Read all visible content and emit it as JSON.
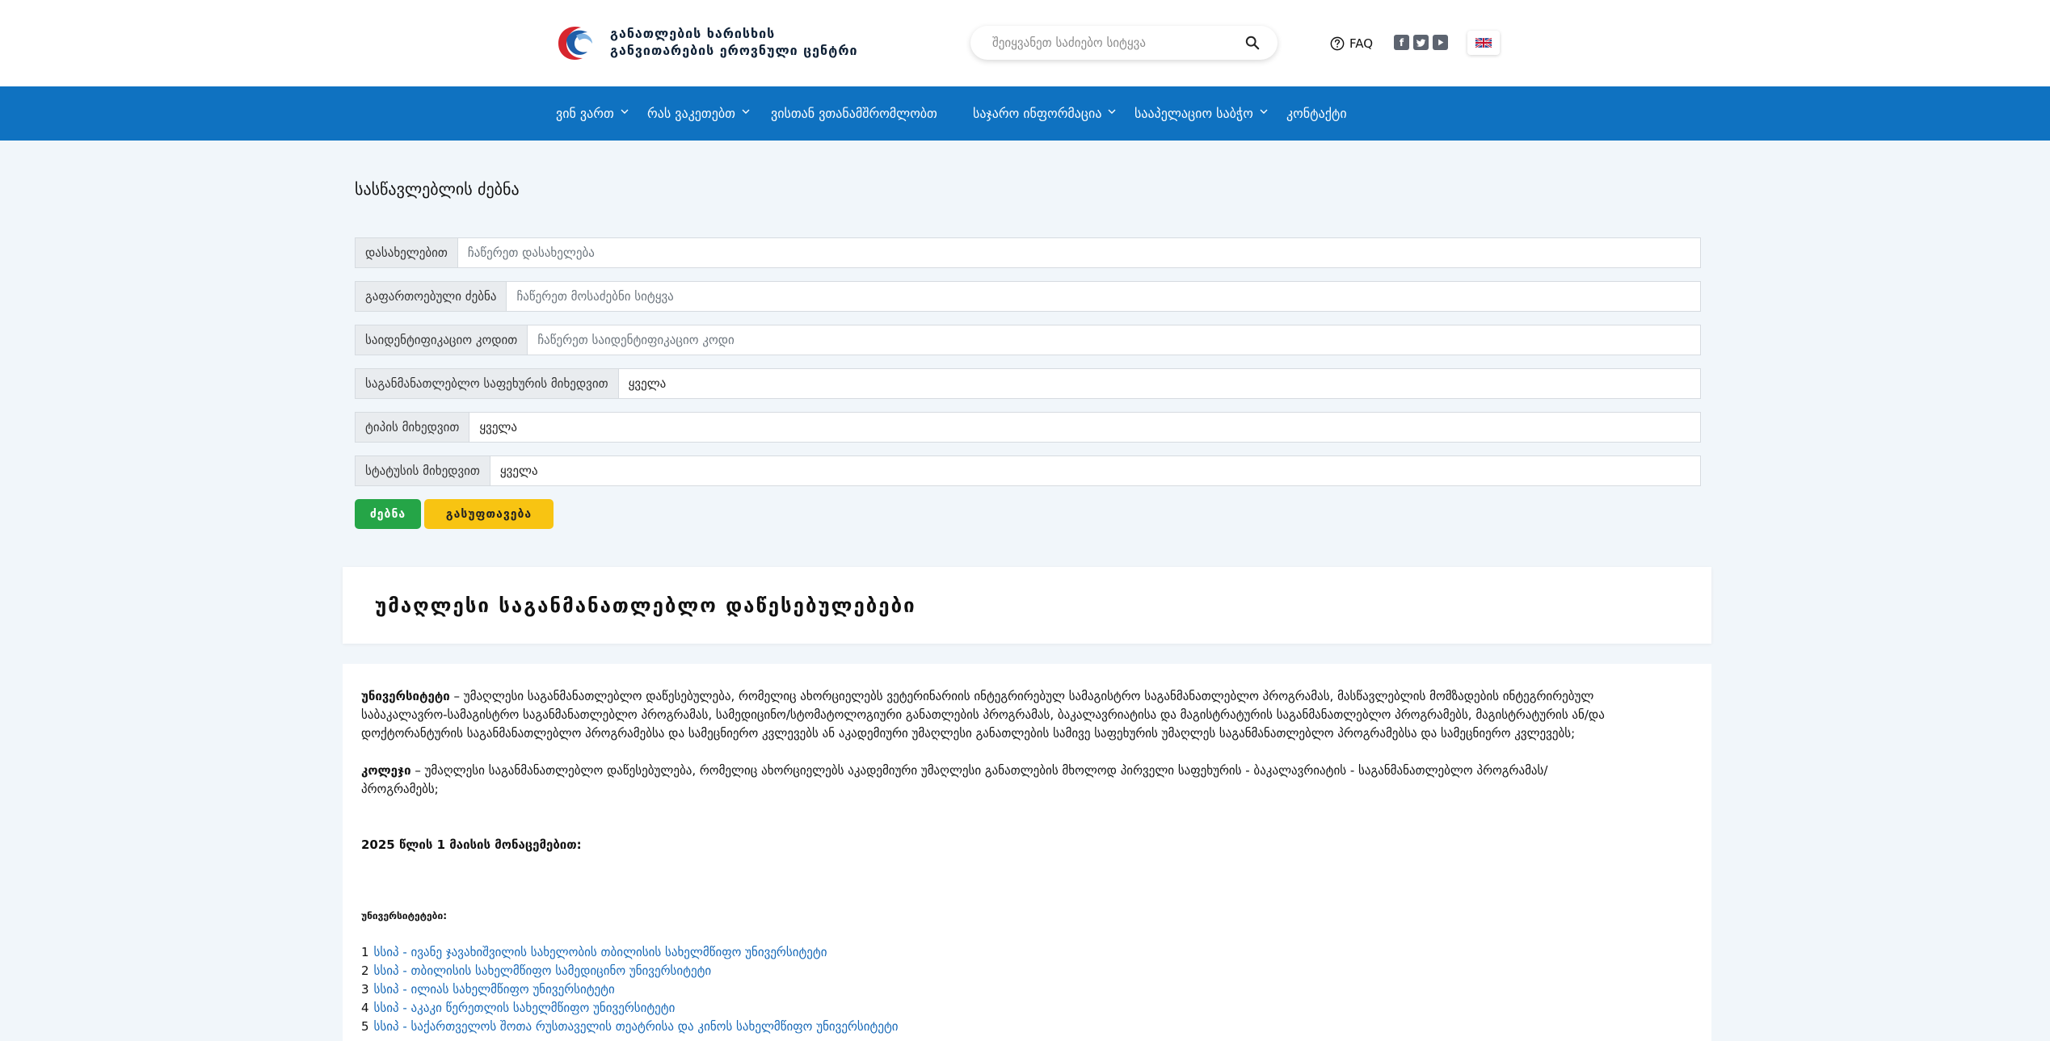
{
  "header": {
    "logo_line1": "განათლების ხარისხის",
    "logo_line2": "განვითარების ეროვნული ცენტრი",
    "search_placeholder": "შეიყვანეთ საძიებო სიტყვა",
    "faq_label": "FAQ",
    "socials": [
      "facebook-icon",
      "twitter-icon",
      "youtube-icon"
    ],
    "lang_flag": "uk-flag-icon"
  },
  "nav": {
    "items": [
      {
        "label": "ვინ ვართ",
        "dropdown": true
      },
      {
        "label": "რას ვაკეთებთ",
        "dropdown": true
      },
      {
        "label": "ვისთან ვთანამშრომლობთ",
        "dropdown": false
      },
      {
        "label": "საჯარო ინფორმაცია",
        "dropdown": true
      },
      {
        "label": "სააპელაციო საბჭო",
        "dropdown": true
      },
      {
        "label": "კონტაქტი",
        "dropdown": false
      }
    ]
  },
  "search_form": {
    "title": "სასწავლებლის ძებნა",
    "fields": [
      {
        "label": "დასახელებით",
        "placeholder": "ჩაწერეთ დასახელება",
        "value": ""
      },
      {
        "label": "გაფართოებული ძებნა",
        "placeholder": "ჩაწერეთ მოსაძებნი სიტყვა",
        "value": ""
      },
      {
        "label": "საიდენტიფიკაციო კოდით",
        "placeholder": "ჩაწერეთ საიდენტიფიკაციო კოდი",
        "value": ""
      },
      {
        "label": "საგანმანათლებლო საფეხურის მიხედვით",
        "placeholder": "",
        "value": "ყველა"
      },
      {
        "label": "ტიპის მიხედვით",
        "placeholder": "",
        "value": "ყველა"
      },
      {
        "label": "სტატუსის მიხედვით",
        "placeholder": "",
        "value": "ყველა"
      }
    ],
    "search_button": "ძებნა",
    "clear_button": "გასუფთავება"
  },
  "content": {
    "heading": "უმაღლესი საგანმანათლებლო დაწესებულებები",
    "university_term": "უნივერსიტეტი",
    "university_def_1": " – უმაღლესი საგანმანათლებლო დაწესებულება, რომელიც ახორციელებს ვეტერინარიის ინტეგრირებულ სამაგისტრო საგანმანათლებლო პროგრამას, მასწავლებლის მომზადების ინტეგრირებულ",
    "university_def_2": "საბაკალავრო-სამაგისტრო საგანმანათლებლო პროგრამას, სამედიცინო/სტომატოლოგიური განათლების პროგრამას, ბაკალავრიატისა და მაგისტრატურის საგანმანათლებლო პროგრამებს, მაგისტრატურის ან/და",
    "university_def_3": "დოქტორანტურის საგანმანათლებლო პროგრამებსა და სამეცნიერო კვლევებს ან აკადემიური უმაღლესი განათლების სამივე საფეხურის უმაღლეს საგანმანათლებლო პროგრამებსა და სამეცნიერო კვლევებს;",
    "college_term": "კოლეჯი",
    "college_def_1": " – უმაღლესი საგანმანათლებლო დაწესებულება, რომელიც ახორციელებს აკადემიური უმაღლესი განათლების მხოლოდ პირველი საფეხურის - ბაკალავრიატის - საგანმანათლებლო პროგრამას/",
    "college_def_2": "პროგრამებს;",
    "data_date": "2025 წლის 1 მაისის მონაცემებით:",
    "universities_heading": "უნივერსიტეტები:",
    "universities": [
      {
        "num": "1",
        "name": "სსიპ - ივანე ჯავახიშვილის სახელობის თბილისის სახელმწიფო უნივერსიტეტი"
      },
      {
        "num": "2",
        "name": "სსიპ - თბილისის სახელმწიფო სამედიცინო უნივერსიტეტი"
      },
      {
        "num": "3",
        "name": "სსიპ - ილიას სახელმწიფო უნივერსიტეტი"
      },
      {
        "num": "4",
        "name": "სსიპ - აკაკი წერეთლის სახელმწიფო უნივერსიტეტი"
      },
      {
        "num": "5",
        "name": "სსიპ - საქართველოს შოთა რუსთაველის თეატრისა და კინოს სახელმწიფო უნივერსიტეტი"
      }
    ]
  },
  "colors": {
    "nav_bg": "#0f72c1",
    "search_btn": "#25a547",
    "clear_btn": "#f8c412",
    "link": "#1668b7"
  }
}
